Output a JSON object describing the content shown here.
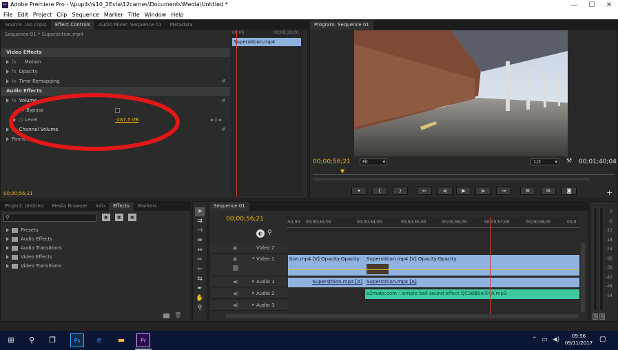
{
  "window": {
    "title": "Adobe Premiere Pro - \\\\pupils\\$10_2Esta\\12carnes\\Documents\\Media\\Untitled *"
  },
  "menu": [
    "File",
    "Edit",
    "Project",
    "Clip",
    "Sequence",
    "Marker",
    "Title",
    "Window",
    "Help"
  ],
  "effect_controls": {
    "tabs": [
      "Source: (no clips)",
      "Effect Controls",
      "Audio Mixer: Sequence 01",
      "Metadata"
    ],
    "clip_path": "Sequence 01 * Superstition.mp4",
    "mini_time_left": "00;00",
    "mini_time_right": "00;00;30;00",
    "mini_clip": "Superstition.mp4",
    "video_effects": "Video Effects",
    "motion": "Motion",
    "opacity": "Opacity",
    "time_remapping": "Time Remapping",
    "audio_effects": "Audio Effects",
    "volume": "Volume",
    "bypass": "Bypass",
    "level": "Level",
    "level_value": "-287.5 dB",
    "channel_volume": "Channel Volume",
    "panner": "Panner",
    "current_time": "00;00;56;21"
  },
  "program": {
    "tab": "Program: Sequence 01",
    "time_left": "00;00;56;21",
    "zoom": "Fit",
    "quality": "1/2",
    "time_right": "00;01;40;04"
  },
  "project": {
    "tabs": [
      "Project: Untitled",
      "Media Browser",
      "Info",
      "Effects",
      "Markers"
    ],
    "active_tab": "Effects",
    "search_placeholder": "",
    "items": [
      "Presets",
      "Audio Effects",
      "Audio Transitions",
      "Video Effects",
      "Video Transitions"
    ]
  },
  "timeline": {
    "tab": "Sequence 01",
    "time": "00;00;56;21",
    "ruler": [
      ";52;00",
      "00;00;53;00",
      "00;00;54;00",
      "00;00;55;00",
      "00;00;56;00",
      "00;00;57;00",
      "00;00;58;00",
      "00;0"
    ],
    "tracks": [
      "Video 2",
      "Video 1",
      "Audio 1",
      "Audio 2",
      "Audio 3"
    ],
    "v1_clip_a": "tion.mp4 [V]  Opacity:Opacity",
    "v1_clip_b": "Superstition.mp4 [V]  Opacity:Opacity",
    "a1_clip_a": "Superstition.mp4 [A]",
    "a1_clip_b": "Superstition.mp4 [A]",
    "a2_clip": "v2mate.com - simple ball sound effect QC2dB0vlX4A.mp3"
  },
  "audio_meter": {
    "ticks": [
      "0",
      "-6",
      "-12",
      "-18",
      "-24",
      "-30",
      "-36",
      "-42",
      "-48",
      "-54"
    ],
    "solo": "S"
  },
  "taskbar": {
    "clock_time": "09:56",
    "clock_date": "09/11/2017"
  },
  "colors": {
    "accent_yellow": "#f0b60a",
    "playhead": "#d33a2a",
    "annotation": "#e01818",
    "clip_blue": "#8fb3de",
    "audio_green": "#3fc9a0",
    "taskbar": "#0a1633"
  }
}
